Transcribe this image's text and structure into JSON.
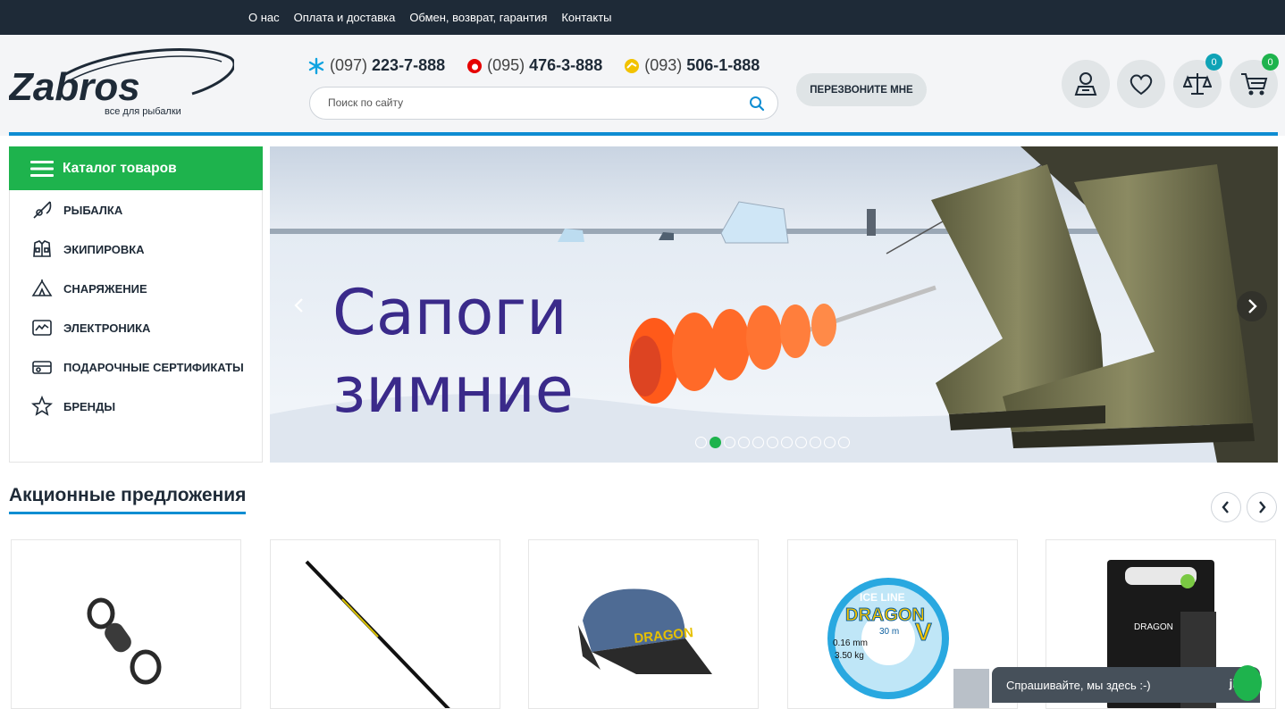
{
  "topbar": {
    "links": [
      "О нас",
      "Оплата и доставка",
      "Обмен, возврат, гарантия",
      "Контакты"
    ]
  },
  "header": {
    "logo_text": "Zabros",
    "logo_tagline": "все для рыбалки",
    "phones": [
      {
        "code": "(097)",
        "number": "223-7-888",
        "operator": "kyivstar"
      },
      {
        "code": "(095)",
        "number": "476-3-888",
        "operator": "vodafone"
      },
      {
        "code": "(093)",
        "number": "506-1-888",
        "operator": "lifecell"
      }
    ],
    "search_placeholder": "Поиск по сайту",
    "callback_label": "ПЕРЕЗВОНИТЕ МНЕ",
    "compare_count": "0",
    "cart_count": "0"
  },
  "catalog": {
    "title": "Каталог товаров",
    "items": [
      {
        "label": "РЫБАЛКА",
        "icon": "fishing-rod-icon"
      },
      {
        "label": "ЭКИПИРОВКА",
        "icon": "vest-icon"
      },
      {
        "label": "СНАРЯЖЕНИЕ",
        "icon": "tent-icon"
      },
      {
        "label": "ЭЛЕКТРОНИКА",
        "icon": "echo-sounder-icon"
      },
      {
        "label": "ПОДАРОЧНЫЕ СЕРТИФИКАТЫ",
        "icon": "gift-card-icon"
      },
      {
        "label": "БРЕНДЫ",
        "icon": "star-icon"
      }
    ]
  },
  "slider": {
    "line1": "Сапоги",
    "line2": "зимние",
    "dot_count": 11,
    "active_dot": 1
  },
  "promo": {
    "title": "Акционные предложения"
  },
  "products": [
    {
      "name": "swivel"
    },
    {
      "name": "fishing rod"
    },
    {
      "name": "cap",
      "brand_text": "DRAGON"
    },
    {
      "name": "fishing line",
      "brand_text": "DRAGON",
      "line_text": "ICE LINE",
      "length": "30 m",
      "diameter": "0.16 mm",
      "strength": "3.50 kg"
    },
    {
      "name": "fishing line box",
      "brand_text": "DRAGON"
    }
  ],
  "chat": {
    "text": "Спрашивайте, мы здесь :-)",
    "brand": "jivo"
  },
  "colors": {
    "dark": "#1e2a37",
    "green": "#1eb34d",
    "blue": "#0f8dd2"
  }
}
